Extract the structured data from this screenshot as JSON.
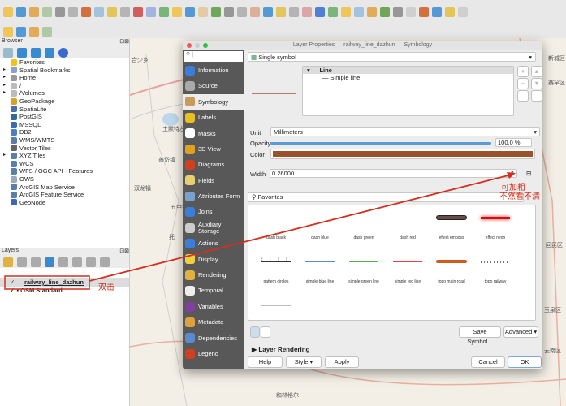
{
  "browser": {
    "title": "Browser",
    "items": [
      {
        "label": "Favorites",
        "color": "#f2c21b"
      },
      {
        "label": "Spatial Bookmarks",
        "color": "#8aa2c8"
      },
      {
        "label": "Home",
        "color": "#999"
      },
      {
        "label": "/",
        "color": "#bbb"
      },
      {
        "label": "/Volumes",
        "color": "#bbb"
      },
      {
        "label": "GeoPackage",
        "color": "#d6a32a"
      },
      {
        "label": "SpatiaLite",
        "color": "#4a6fa8"
      },
      {
        "label": "PostGIS",
        "color": "#336699"
      },
      {
        "label": "MSSQL",
        "color": "#3a6ab0"
      },
      {
        "label": "DB2",
        "color": "#4a7fc0"
      },
      {
        "label": "WMS/WMTS",
        "color": "#5a7fa8"
      },
      {
        "label": "Vector Tiles",
        "color": "#666"
      },
      {
        "label": "XYZ Tiles",
        "color": "#5a7fa8"
      },
      {
        "label": "WCS",
        "color": "#5a7fa8"
      },
      {
        "label": "WFS / OGC API - Features",
        "color": "#5a7fa8"
      },
      {
        "label": "OWS",
        "color": "#9ab"
      },
      {
        "label": "ArcGIS Map Service",
        "color": "#5a7fa8"
      },
      {
        "label": "ArcGIS Feature Service",
        "color": "#5a7fa8"
      },
      {
        "label": "GeoNode",
        "color": "#3a6ab0"
      }
    ]
  },
  "layers": {
    "title": "Layers",
    "items": [
      {
        "label": "railway_line_dazhun",
        "checked": true
      },
      {
        "label": "OSM Standard",
        "checked": true
      }
    ]
  },
  "dialog": {
    "title": "Layer Properties — railway_line_dazhun — Symbology",
    "nav": [
      {
        "label": "Information",
        "color": "#3b7dd8"
      },
      {
        "label": "Source",
        "color": "#aaa"
      },
      {
        "label": "Symbology",
        "color": "#c99a5a"
      },
      {
        "label": "Labels",
        "color": "#e8c020"
      },
      {
        "label": "Masks",
        "color": "#fff"
      },
      {
        "label": "3D View",
        "color": "#e0a020"
      },
      {
        "label": "Diagrams",
        "color": "#d04020"
      },
      {
        "label": "Fields",
        "color": "#e8d070"
      },
      {
        "label": "Attributes Form",
        "color": "#7aa0d0"
      },
      {
        "label": "Joins",
        "color": "#3b7dd8"
      },
      {
        "label": "Auxiliary Storage",
        "color": "#ccc"
      },
      {
        "label": "Actions",
        "color": "#3b7dd8"
      },
      {
        "label": "Display",
        "color": "#f0d040"
      },
      {
        "label": "Rendering",
        "color": "#e0b040"
      },
      {
        "label": "Temporal",
        "color": "#eee"
      },
      {
        "label": "Variables",
        "color": "#8040a0"
      },
      {
        "label": "Metadata",
        "color": "#e0a040"
      },
      {
        "label": "Dependencies",
        "color": "#5a8ad0"
      },
      {
        "label": "Legend",
        "color": "#d04020"
      }
    ],
    "active_nav": "Symbology",
    "renderer": "Single symbol",
    "symbol_tree": {
      "root": "Line",
      "child": "Simple line"
    },
    "unit_label": "Unit",
    "unit": "Millimeters",
    "opacity_label": "Opacity",
    "opacity": "100.0 %",
    "opacity_value": 100,
    "color_label": "Color",
    "color": "#9a522a",
    "width_label": "Width",
    "width": "0.26000",
    "search_value": "Favorites",
    "symbols": [
      {
        "label": "dash  black",
        "color": "#333",
        "style": "dotted"
      },
      {
        "label": "dash blue",
        "color": "#5b9bd5",
        "style": "dotted"
      },
      {
        "label": "dash green",
        "color": "#6c6",
        "style": "dotted"
      },
      {
        "label": "dash red",
        "color": "#e05050",
        "style": "dotted"
      },
      {
        "label": "effect emboss",
        "color": "#6a4a48",
        "style": "thick"
      },
      {
        "label": "effect neon",
        "color": "#d01010",
        "style": "neon"
      },
      {
        "label": "pattern circles",
        "color": "#333",
        "style": "circles"
      },
      {
        "label": "simple blue line",
        "color": "#5b8ad0",
        "style": "solid"
      },
      {
        "label": "simple green line",
        "color": "#5ab05a",
        "style": "solid"
      },
      {
        "label": "simple red line",
        "color": "#e04050",
        "style": "solid"
      },
      {
        "label": "topo main road",
        "color": "#d05a20",
        "style": "road"
      },
      {
        "label": "topo railway",
        "color": "#777",
        "style": "rail"
      },
      {
        "label": "",
        "color": "#bbb",
        "style": "solid"
      }
    ],
    "save_symbol": "Save Symbol...",
    "advanced": "Advanced",
    "layer_rendering": "Layer Rendering",
    "buttons": {
      "help": "Help",
      "style": "Style",
      "apply": "Apply",
      "cancel": "Cancel",
      "ok": "OK"
    }
  },
  "annotations": {
    "double_click": "双击",
    "thicken_1": "可加粗",
    "thicken_2": "不然看不清",
    "color": "#d32f1f"
  },
  "map_labels": [
    "合少乡",
    "土默特左",
    "五申镇",
    "善岱镇",
    "双龙镇",
    "托",
    "新城区",
    "赛罕区",
    "回民区",
    "玉泉区",
    "云南区",
    "和林格尔"
  ]
}
